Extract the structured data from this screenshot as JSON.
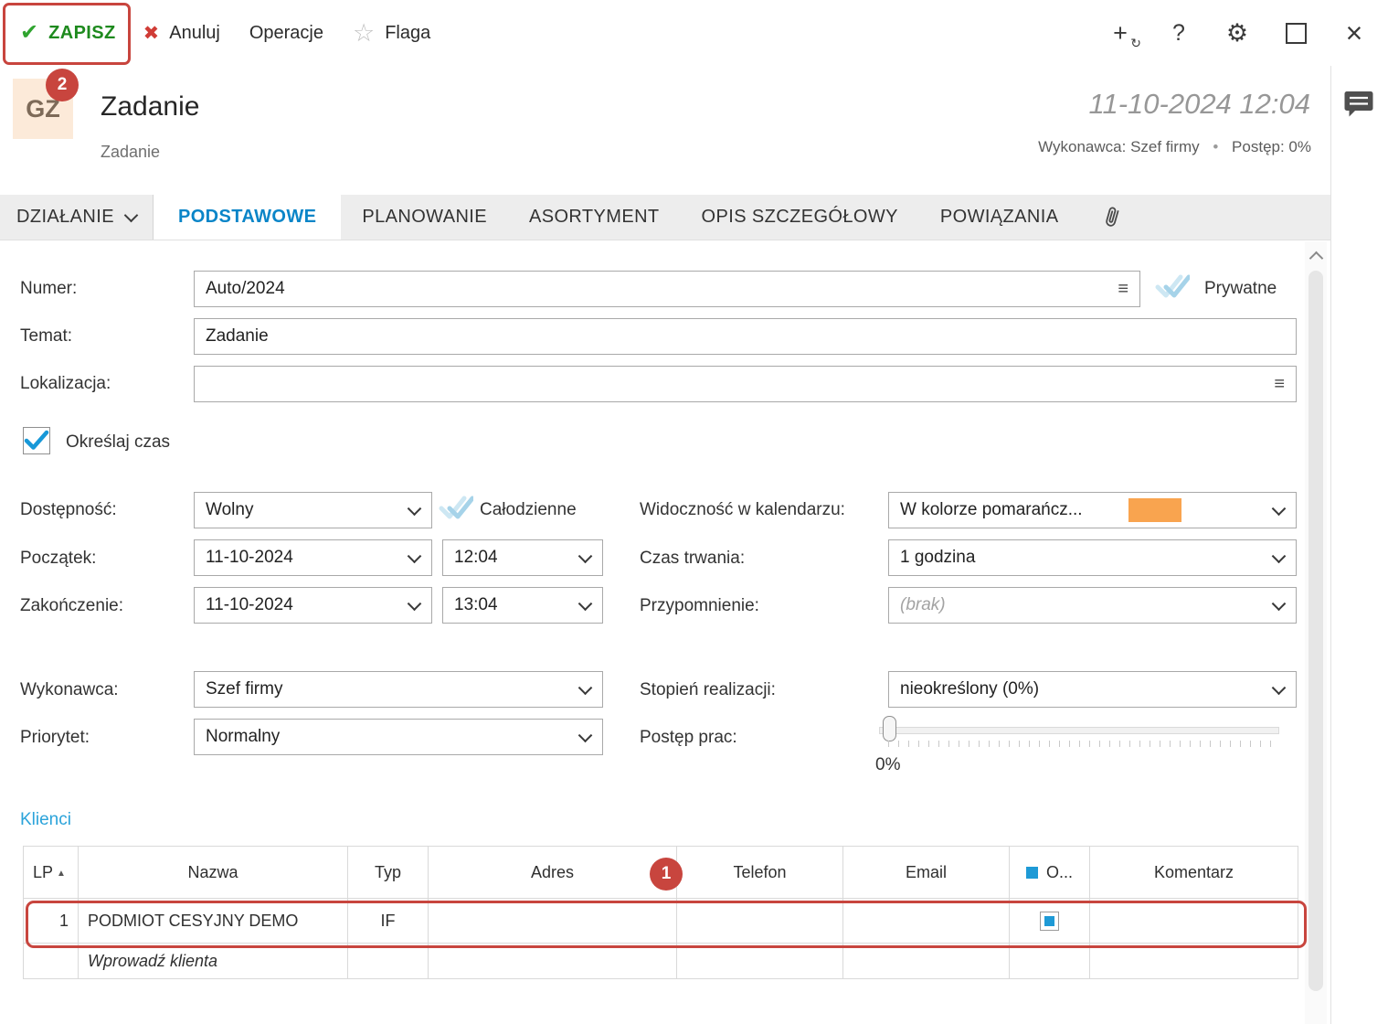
{
  "toolbar": {
    "save": "ZAPISZ",
    "cancel": "Anuluj",
    "operations": "Operacje",
    "flag": "Flaga"
  },
  "header": {
    "avatar": "GZ",
    "title": "Zadanie",
    "subtitle": "Zadanie",
    "datetime": "11-10-2024 12:04",
    "meta_executor": "Wykonawca: Szef firmy",
    "meta_separator": "•",
    "meta_progress": "Postęp: 0%"
  },
  "tabs": [
    {
      "label": "DZIAŁANIE"
    },
    {
      "label": "PODSTAWOWE"
    },
    {
      "label": "PLANOWANIE"
    },
    {
      "label": "ASORTYMENT"
    },
    {
      "label": "OPIS SZCZEGÓŁOWY"
    },
    {
      "label": "POWIĄZANIA"
    }
  ],
  "form": {
    "numer": {
      "label": "Numer:",
      "value": "Auto/2024"
    },
    "prywatne_label": "Prywatne",
    "temat": {
      "label": "Temat:",
      "value": "Zadanie"
    },
    "lokalizacja": {
      "label": "Lokalizacja:",
      "value": ""
    },
    "okreslaj_czas_label": "Określaj czas",
    "dostepnosc": {
      "label": "Dostępność:",
      "value": "Wolny"
    },
    "calodzienne_label": "Całodzienne",
    "widocznosc": {
      "label": "Widoczność w kalendarzu:",
      "value": "W kolorze pomarańcz..."
    },
    "poczatek": {
      "label": "Początek:",
      "date": "11-10-2024",
      "time": "12:04"
    },
    "czas_trwania": {
      "label": "Czas trwania:",
      "value": "1 godzina"
    },
    "zakonczenie": {
      "label": "Zakończenie:",
      "date": "11-10-2024",
      "time": "13:04"
    },
    "przypomnienie": {
      "label": "Przypomnienie:",
      "value": "(brak)"
    },
    "wykonawca": {
      "label": "Wykonawca:",
      "value": "Szef firmy"
    },
    "stopien": {
      "label": "Stopień realizacji:",
      "value": "nieokreślony (0%)"
    },
    "priorytet": {
      "label": "Priorytet:",
      "value": "Normalny"
    },
    "postep": {
      "label": "Postęp prac:",
      "value": "0%"
    }
  },
  "klienci": {
    "title": "Klienci",
    "columns": [
      "LP",
      "Nazwa",
      "Typ",
      "Adres",
      "Telefon",
      "Email",
      "O...",
      "Komentarz"
    ],
    "rows": [
      {
        "lp": "1",
        "nazwa": "PODMIOT CESYJNY DEMO",
        "typ": "IF",
        "adres": "",
        "telefon": "",
        "email": "",
        "komentarz": ""
      }
    ],
    "placeholder": "Wprowadź klienta"
  },
  "annotations": {
    "step1": "1",
    "step2": "2"
  },
  "icons": {
    "save_check": "✔",
    "cancel_x": "✖",
    "flag_star": "☆",
    "add_plus": "+",
    "add_refresh": "↻",
    "help": "?",
    "settings": "⚙",
    "close": "×",
    "hamburger": "≡",
    "sort_asc": "▲"
  },
  "colors": {
    "accent_blue": "#0a85c8",
    "annotation_red": "#c8453e",
    "orange_swatch": "#f9a44f",
    "save_green": "#1e8a1e",
    "check_blue": "#1e9ad6"
  }
}
